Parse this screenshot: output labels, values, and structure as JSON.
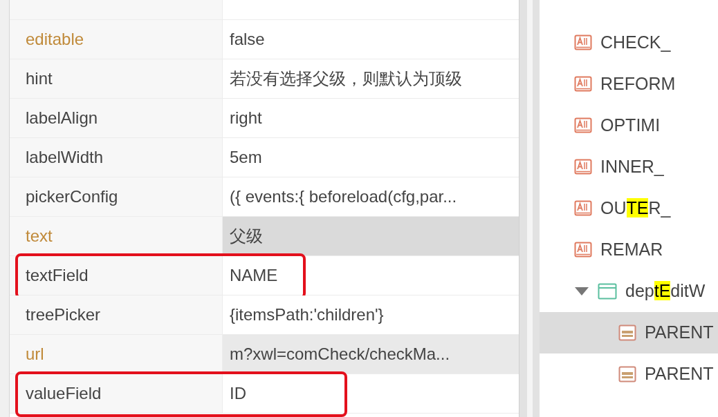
{
  "properties": [
    {
      "name": "editable",
      "value": "false",
      "modified": true,
      "shaded": false,
      "annotated": false
    },
    {
      "name": "hint",
      "value": "若没有选择父级，则默认为顶级",
      "modified": false,
      "shaded": false,
      "annotated": false
    },
    {
      "name": "labelAlign",
      "value": "right",
      "modified": false,
      "shaded": false,
      "annotated": false
    },
    {
      "name": "labelWidth",
      "value": "5em",
      "modified": false,
      "shaded": false,
      "annotated": false
    },
    {
      "name": "pickerConfig",
      "value": "({ events:{ beforeload(cfg,par...",
      "modified": false,
      "shaded": false,
      "annotated": false
    },
    {
      "name": "text",
      "value": "父级",
      "modified": true,
      "shaded": true,
      "annotated": false
    },
    {
      "name": "textField",
      "value": "NAME",
      "modified": false,
      "shaded": false,
      "annotated": true
    },
    {
      "name": "treePicker",
      "value": "{itemsPath:'children'}",
      "modified": false,
      "shaded": false,
      "annotated": false
    },
    {
      "name": "url",
      "value": "m?xwl=comCheck/checkMa...",
      "modified": true,
      "shaded": true,
      "annotated": false
    },
    {
      "name": "valueField",
      "value": "ID",
      "modified": false,
      "shaded": false,
      "annotated": true
    }
  ],
  "tree": [
    {
      "kind": "textfield",
      "selected": false,
      "parts": [
        {
          "text": "CHECK_",
          "hit": false
        }
      ]
    },
    {
      "kind": "textfield",
      "selected": false,
      "parts": [
        {
          "text": "REFORM",
          "hit": false
        }
      ]
    },
    {
      "kind": "textfield",
      "selected": false,
      "parts": [
        {
          "text": "OPTIMI",
          "hit": false
        }
      ]
    },
    {
      "kind": "textfield",
      "selected": false,
      "parts": [
        {
          "text": "INNER_",
          "hit": false
        }
      ]
    },
    {
      "kind": "textfield",
      "selected": false,
      "parts": [
        {
          "text": "OU",
          "hit": false
        },
        {
          "text": "TE",
          "hit": true
        },
        {
          "text": "R_",
          "hit": false
        }
      ]
    },
    {
      "kind": "textfield",
      "selected": false,
      "parts": [
        {
          "text": "REMAR",
          "hit": false
        }
      ]
    },
    {
      "kind": "window",
      "selected": false,
      "expanded": true,
      "parts": [
        {
          "text": "dep",
          "hit": false
        },
        {
          "text": "tE",
          "hit": true
        },
        {
          "text": "ditW",
          "hit": false
        }
      ],
      "children": [
        {
          "kind": "picker",
          "selected": true,
          "parts": [
            {
              "text": "PARENT",
              "hit": false
            }
          ]
        },
        {
          "kind": "picker",
          "selected": false,
          "parts": [
            {
              "text": "PARENT",
              "hit": false
            }
          ]
        }
      ]
    }
  ]
}
